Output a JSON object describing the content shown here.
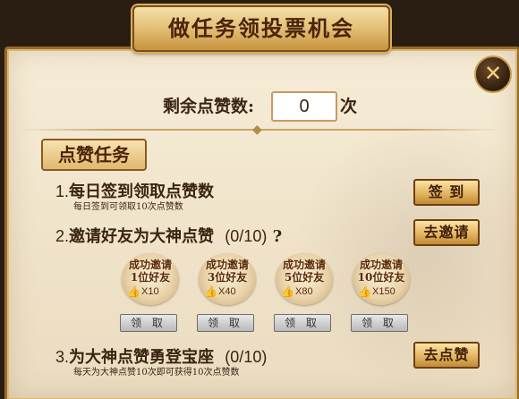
{
  "dialog": {
    "title": "做任务领投票机会",
    "close_icon": "close-icon"
  },
  "remaining": {
    "label": "剩余点赞数:",
    "value": "0",
    "unit": "次"
  },
  "section": {
    "label": "点赞任务"
  },
  "tasks": [
    {
      "number": "1.",
      "title": "每日签到领取点赞数",
      "progress": "",
      "description": "每日签到可领取10次点赞数",
      "button": "签 到"
    },
    {
      "number": "2.",
      "title": "邀请好友为大神点赞",
      "progress": "(0/10)",
      "suffix": "?",
      "description": "",
      "button": "去邀请"
    },
    {
      "number": "3.",
      "title": "为大神点赞勇登宝座",
      "progress": "(0/10)",
      "description": "每天为大神点赞10次即可获得10次点赞数",
      "button": "去点赞"
    }
  ],
  "rewards": [
    {
      "line1": "成功邀请",
      "line2": "1位好友",
      "icon": "thumbs-up-icon",
      "mult": "X10",
      "claim": "领 取"
    },
    {
      "line1": "成功邀请",
      "line2": "3位好友",
      "icon": "thumbs-up-icon",
      "mult": "X40",
      "claim": "领 取"
    },
    {
      "line1": "成功邀请",
      "line2": "5位好友",
      "icon": "thumbs-up-icon",
      "mult": "X80",
      "claim": "领 取"
    },
    {
      "line1": "成功邀请",
      "line2": "10位好友",
      "icon": "thumbs-up-icon",
      "mult": "X150",
      "claim": "领 取"
    }
  ]
}
